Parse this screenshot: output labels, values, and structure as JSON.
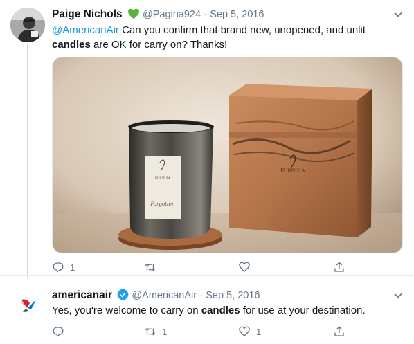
{
  "tweet1": {
    "name": "Paige Nichols",
    "name_badge": "green-heart",
    "handle": "@Pagina924",
    "separator": "·",
    "date": "Sep 5, 2016",
    "mention": "@AmericanAir",
    "text_part1": " Can you confirm that brand new, unopened, and unlit ",
    "keyword": "candles",
    "text_part2": " are OK for carry on? Thanks!",
    "reply_count": "1",
    "retweet_count": "",
    "like_count": "",
    "photo_brand": "FURNUIA",
    "photo_label_script": "Forgotten"
  },
  "tweet2": {
    "name": "americanair",
    "verified": true,
    "handle": "@AmericanAir",
    "separator": "·",
    "date": "Sep 5, 2016",
    "text_part1": "Yes, you're welcome to carry on ",
    "keyword": "candles",
    "text_part2": " for use at your destination.",
    "reply_count": "",
    "retweet_count": "1",
    "like_count": "1"
  },
  "colors": {
    "accent": "#1b95e0",
    "muted": "#657786",
    "heart": "#5ab33c",
    "divider": "#e6ecf0"
  }
}
